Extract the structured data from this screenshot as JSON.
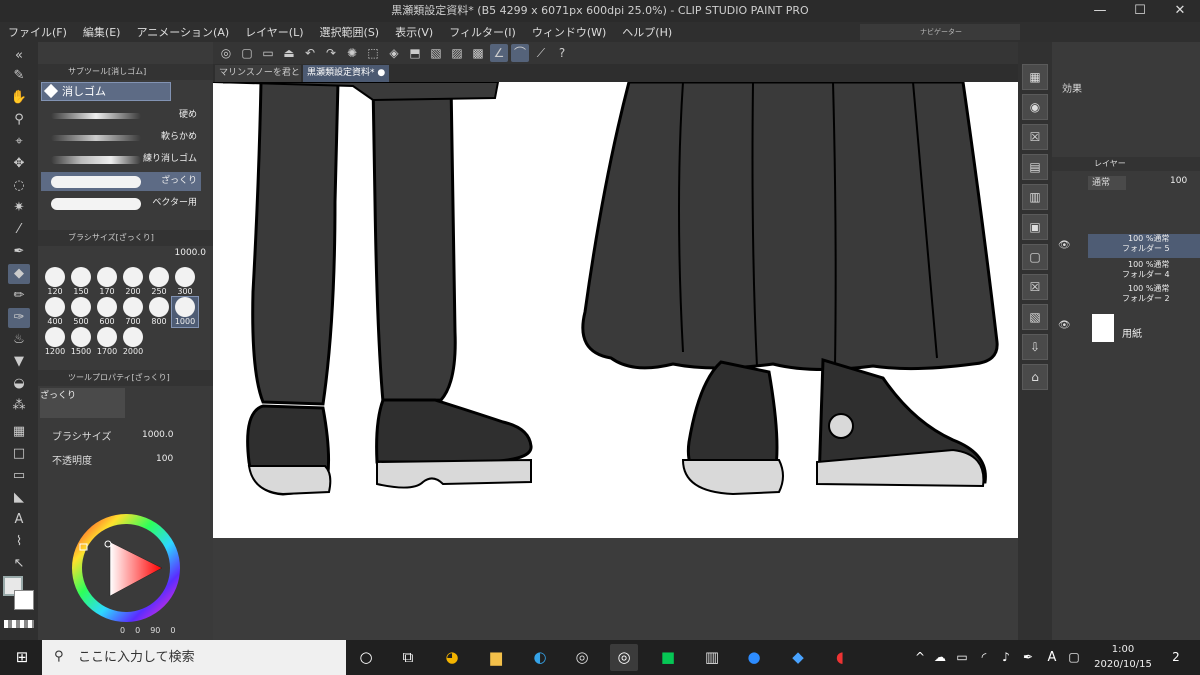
{
  "window": {
    "title": "黒瀬類設定資料* (B5 4299 x 6071px 600dpi 25.0%)  - CLIP STUDIO PAINT PRO",
    "minimize": "—",
    "maximize": "☐",
    "close": "✕"
  },
  "menu": [
    "ファイル(F)",
    "編集(E)",
    "アニメーション(A)",
    "レイヤー(L)",
    "選択範囲(S)",
    "表示(V)",
    "フィルター(I)",
    "ウィンドウ(W)",
    "ヘルプ(H)"
  ],
  "navigator_title": "ナビゲーター",
  "document_tabs": [
    {
      "label": "マリンスノーを君と",
      "close": "✕"
    },
    {
      "label": "黒瀬類設定資料*",
      "close": "●"
    }
  ],
  "subtool": {
    "panel_title": "サブツール[消しゴム]",
    "selected": "消しゴム",
    "brushes": [
      "硬め",
      "軟らかめ",
      "練り消しゴム",
      "ざっくり",
      "ベクター用"
    ],
    "selected_brush": "ざっくり"
  },
  "brush_size": {
    "panel_title": "ブラシサイズ[ざっくり]",
    "value": "1000.0",
    "sizes": [
      "120",
      "150",
      "170",
      "200",
      "250",
      "300",
      "400",
      "500",
      "600",
      "700",
      "800",
      "1000",
      "1200",
      "1500",
      "1700",
      "2000"
    ],
    "selected": "1000"
  },
  "tool_property": {
    "panel_title": "ツールプロパティ[ざっくり]",
    "name": "ざっくり",
    "brush_size_label": "ブラシサイズ",
    "brush_size_value": "1000.0",
    "opacity_label": "不透明度",
    "opacity_value": "100"
  },
  "color": {
    "main": "#e8e8e8",
    "sub": "#ffffff",
    "readout": [
      "0",
      "0",
      "90",
      "0"
    ]
  },
  "effects": {
    "label": "効果"
  },
  "layer_panel": {
    "title": "レイヤー",
    "blend_mode": "通常",
    "opacity": "100",
    "layers": [
      {
        "top": "100 %通常",
        "name": "フォルダー 5",
        "visible": true,
        "selected": true
      },
      {
        "top": "100 %通常",
        "name": "フォルダー 4",
        "visible": false,
        "selected": false
      },
      {
        "top": "100 %通常",
        "name": "フォルダー 2",
        "visible": false,
        "selected": false
      },
      {
        "top": "",
        "name": "用紙",
        "visible": true,
        "selected": false
      }
    ]
  },
  "taskbar": {
    "search_placeholder": "ここに入力して検索",
    "time": "1:00",
    "date": "2020/10/15",
    "ime": "A",
    "notification_count": "2"
  },
  "colors": {
    "accent": "#55637a",
    "canvas": "#ffffff",
    "ink": "#000000",
    "pants": "#3a3a3a",
    "shoe_sole": "#d9d9d9"
  }
}
